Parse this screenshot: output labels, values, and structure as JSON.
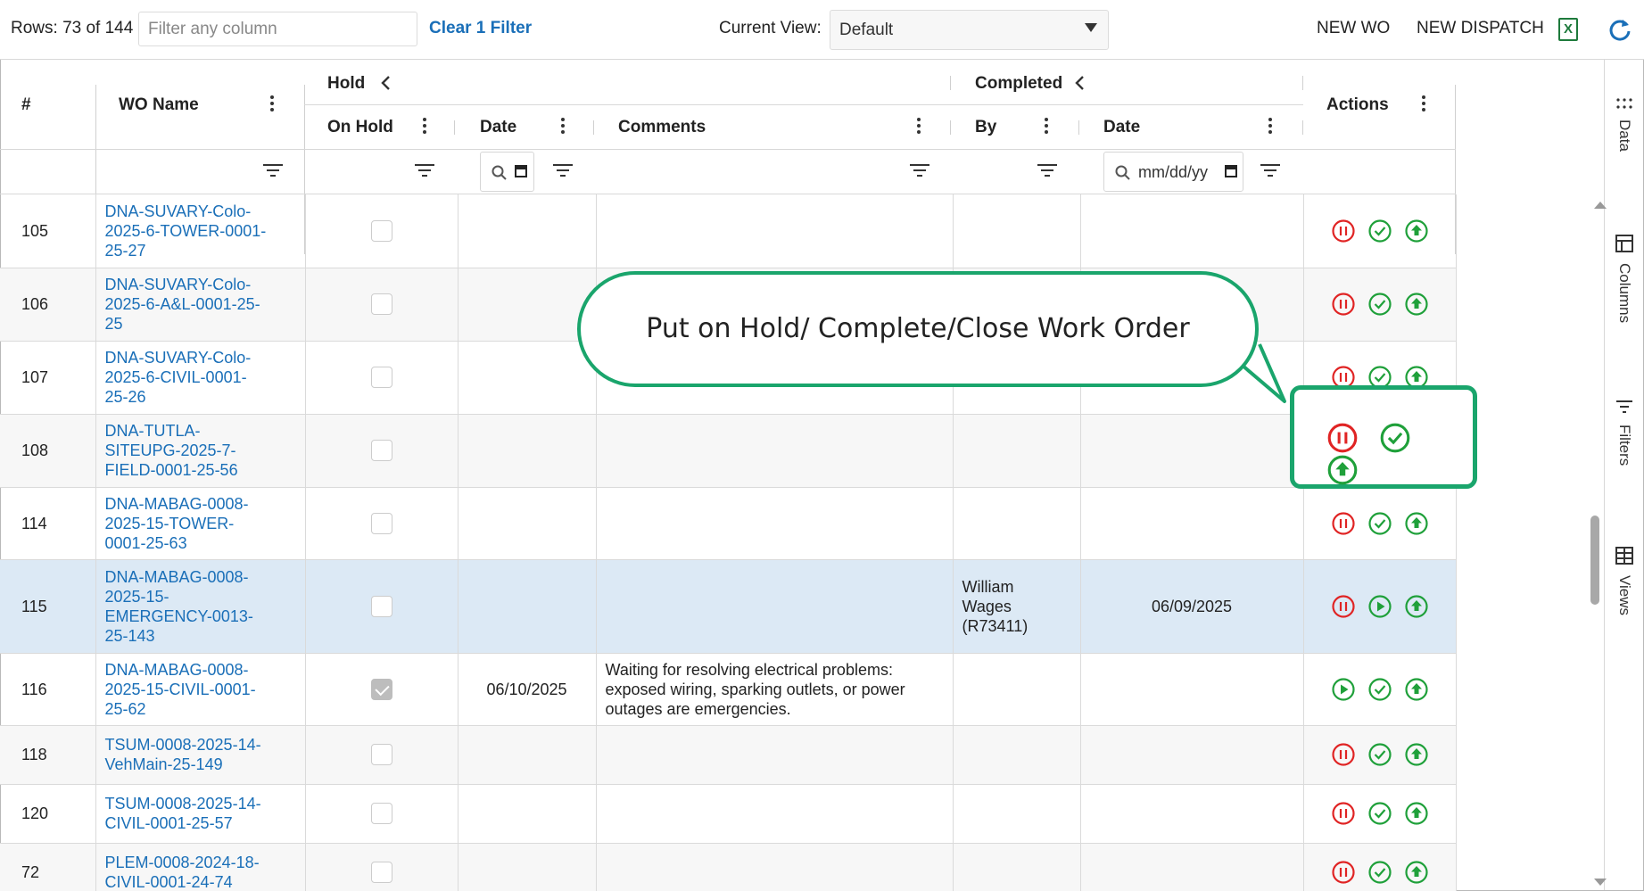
{
  "toolbar": {
    "rows_label": "Rows: 73 of 144",
    "filter_placeholder": "Filter any column",
    "clear_filter": "Clear 1 Filter",
    "current_view_label": "Current View:",
    "current_view_value": "Default",
    "new_wo": "NEW WO",
    "new_dispatch": "NEW DISPATCH",
    "excel_icon": "excel-export-icon",
    "refresh_icon": "refresh-icon"
  },
  "side_panel": {
    "data": "Data",
    "columns": "Columns",
    "filters": "Filters",
    "views": "Views"
  },
  "columns": {
    "num": "#",
    "wo_name": "WO Name",
    "hold_group": "Hold",
    "on_hold": "On Hold",
    "hold_date": "Date",
    "comments": "Comments",
    "completed_group": "Completed",
    "by": "By",
    "completed_date": "Date",
    "actions": "Actions",
    "date_placeholder": "mm/dd/yy"
  },
  "rows": [
    {
      "num": "105",
      "wo_name": "DNA-SUVARY-Colo-\n2025-6-TOWER-0001-\n25-27",
      "on_hold": false,
      "hold_date": "",
      "comments": "",
      "by": "",
      "completed_date": "",
      "first_action": "pause"
    },
    {
      "num": "106",
      "wo_name": "DNA-SUVARY-Colo-\n2025-6-A&L-0001-25-\n25",
      "on_hold": false,
      "hold_date": "",
      "comments": "",
      "by": "",
      "completed_date": "",
      "first_action": "pause"
    },
    {
      "num": "107",
      "wo_name": "DNA-SUVARY-Colo-\n2025-6-CIVIL-0001-\n25-26",
      "on_hold": false,
      "hold_date": "",
      "comments": "",
      "by": "",
      "completed_date": "",
      "first_action": "pause"
    },
    {
      "num": "108",
      "wo_name": "DNA-TUTLA-\nSITEUPG-2025-7-\nFIELD-0001-25-56",
      "on_hold": false,
      "hold_date": "",
      "comments": "",
      "by": "",
      "completed_date": "",
      "first_action": "pause"
    },
    {
      "num": "114",
      "wo_name": "DNA-MABAG-0008-\n2025-15-TOWER-\n0001-25-63",
      "on_hold": false,
      "hold_date": "",
      "comments": "",
      "by": "",
      "completed_date": "",
      "first_action": "pause"
    },
    {
      "num": "115",
      "wo_name": "DNA-MABAG-0008-\n2025-15-\nEMERGENCY-0013-\n25-143",
      "on_hold": false,
      "hold_date": "",
      "comments": "",
      "by": "William\nWages\n(R73411)",
      "completed_date": "06/09/2025",
      "first_action": "pause",
      "second_action": "play",
      "selected": true
    },
    {
      "num": "116",
      "wo_name": "DNA-MABAG-0008-\n2025-15-CIVIL-0001-\n25-62",
      "on_hold": true,
      "hold_date": "06/10/2025",
      "comments": "Waiting for resolving electrical problems: exposed wiring, sparking outlets, or power outages are emergencies.",
      "by": "",
      "completed_date": "",
      "first_action": "play"
    },
    {
      "num": "118",
      "wo_name": "TSUM-0008-2025-14-\nVehMain-25-149",
      "on_hold": false,
      "hold_date": "",
      "comments": "",
      "by": "",
      "completed_date": "",
      "first_action": "pause"
    },
    {
      "num": "120",
      "wo_name": "TSUM-0008-2025-14-\nCIVIL-0001-25-57",
      "on_hold": false,
      "hold_date": "",
      "comments": "",
      "by": "",
      "completed_date": "",
      "first_action": "pause"
    },
    {
      "num": "72",
      "wo_name": "PLEM-0008-2024-18-\nCIVIL-0001-24-74",
      "on_hold": false,
      "hold_date": "",
      "comments": "",
      "by": "",
      "completed_date": "",
      "first_action": "pause"
    }
  ],
  "callout": {
    "text": "Put on Hold/ Complete/Close Work Order"
  },
  "colors": {
    "link": "#1a6fb8",
    "pause_red": "#e02424",
    "action_green": "#1fa03a",
    "callout_green": "#1aa56c",
    "selected_row": "#dce9f5"
  }
}
